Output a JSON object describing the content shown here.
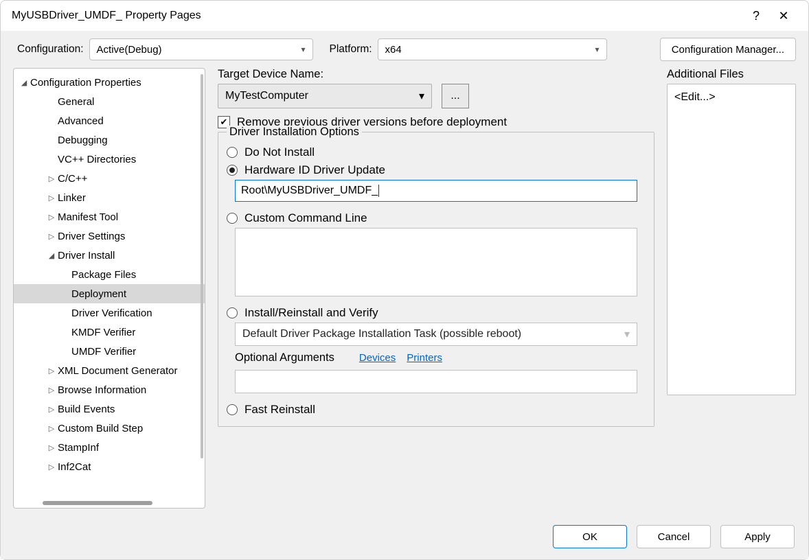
{
  "window": {
    "title": "MyUSBDriver_UMDF_ Property Pages",
    "help": "?",
    "close": "✕"
  },
  "topbar": {
    "config_label": "Configuration:",
    "config_value": "Active(Debug)",
    "platform_label": "Platform:",
    "platform_value": "x64",
    "manager_btn": "Configuration Manager..."
  },
  "tree": {
    "root": "Configuration Properties",
    "items": [
      {
        "label": "General",
        "indent": 2,
        "arrow": ""
      },
      {
        "label": "Advanced",
        "indent": 2,
        "arrow": ""
      },
      {
        "label": "Debugging",
        "indent": 2,
        "arrow": ""
      },
      {
        "label": "VC++ Directories",
        "indent": 2,
        "arrow": ""
      },
      {
        "label": "C/C++",
        "indent": 2,
        "arrow": "▷"
      },
      {
        "label": "Linker",
        "indent": 2,
        "arrow": "▷"
      },
      {
        "label": "Manifest Tool",
        "indent": 2,
        "arrow": "▷"
      },
      {
        "label": "Driver Settings",
        "indent": 2,
        "arrow": "▷"
      },
      {
        "label": "Driver Install",
        "indent": 2,
        "arrow": "◢"
      },
      {
        "label": "Package Files",
        "indent": 3,
        "arrow": ""
      },
      {
        "label": "Deployment",
        "indent": 3,
        "arrow": "",
        "selected": true
      },
      {
        "label": "Driver Verification",
        "indent": 3,
        "arrow": ""
      },
      {
        "label": "KMDF Verifier",
        "indent": 3,
        "arrow": ""
      },
      {
        "label": "UMDF Verifier",
        "indent": 3,
        "arrow": ""
      },
      {
        "label": "XML Document Generator",
        "indent": 2,
        "arrow": "▷"
      },
      {
        "label": "Browse Information",
        "indent": 2,
        "arrow": "▷"
      },
      {
        "label": "Build Events",
        "indent": 2,
        "arrow": "▷"
      },
      {
        "label": "Custom Build Step",
        "indent": 2,
        "arrow": "▷"
      },
      {
        "label": "StampInf",
        "indent": 2,
        "arrow": "▷"
      },
      {
        "label": "Inf2Cat",
        "indent": 2,
        "arrow": "▷"
      }
    ]
  },
  "deploy": {
    "target_label": "Target Device Name:",
    "target_value": "MyTestComputer",
    "browse": "...",
    "remove_label": "Remove previous driver versions before deployment",
    "remove_checked": true,
    "group_legend": "Driver Installation Options",
    "radio_do_not": "Do Not Install",
    "radio_hwid": "Hardware ID Driver Update",
    "hwid_value": "Root\\MyUSBDriver_UMDF_",
    "radio_custom": "Custom Command Line",
    "radio_install": "Install/Reinstall and Verify",
    "install_combo": "Default Driver Package Installation Task (possible reboot)",
    "opt_args_label": "Optional Arguments",
    "link_devices": "Devices",
    "link_printers": "Printers",
    "radio_fast": "Fast Reinstall"
  },
  "files": {
    "label": "Additional Files",
    "edit": "<Edit...>"
  },
  "buttons": {
    "ok": "OK",
    "cancel": "Cancel",
    "apply": "Apply"
  }
}
